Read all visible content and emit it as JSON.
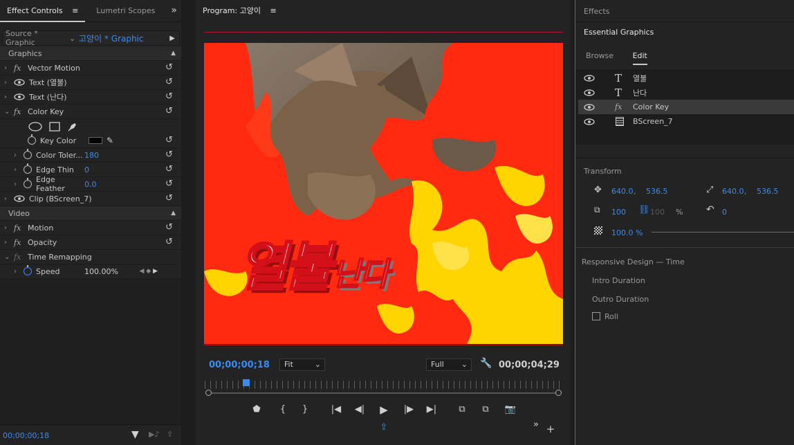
{
  "effect_controls": {
    "tabs": [
      {
        "label": "Effect Controls",
        "menu": "≡"
      },
      {
        "label": "Lumetri Scopes"
      }
    ],
    "overflow": "»",
    "source_label": "Source * Graphic",
    "sequence_clip_label": "고양이 * Graphic",
    "sections": {
      "graphics": "Graphics",
      "video": "Video"
    },
    "rows": {
      "vector_motion": "Vector Motion",
      "text1": "Text (열불)",
      "text2": "Text (난다)",
      "color_key": "Color Key",
      "key_color": "Key Color",
      "color_tolerance": "Color Toler...",
      "color_tolerance_value": "180",
      "edge_thin": "Edge Thin",
      "edge_thin_value": "0",
      "edge_feather": "Edge Feather",
      "edge_feather_value": "0.0",
      "clip": "Clip (BScreen_7)",
      "motion": "Motion",
      "opacity": "Opacity",
      "time_remapping": "Time Remapping",
      "speed": "Speed",
      "speed_value": "100.00%"
    },
    "timecode": "00;00;00;18"
  },
  "program": {
    "title": "Program: 고양이",
    "menu": "≡",
    "overlay_text_big": "열불",
    "overlay_text_small": "난다",
    "current_time": "00;00;00;18",
    "fit": "Fit",
    "quality": "Full",
    "duration": "00;00;04;29"
  },
  "essential_graphics": {
    "effects_tab": "Effects",
    "panel_title": "Essential Graphics",
    "tabs": {
      "browse": "Browse",
      "edit": "Edit"
    },
    "layers": [
      {
        "name": "열불",
        "icon": "T"
      },
      {
        "name": "난다",
        "icon": "T"
      },
      {
        "name": "Color Key",
        "icon": "fx"
      },
      {
        "name": "BScreen_7",
        "icon": "film"
      }
    ],
    "transform_label": "Transform",
    "position_x": "640.0",
    "position_y": "536.5",
    "anchor_x": "640.0",
    "anchor_y": "536.5",
    "scale": "100",
    "scale_linked": "100",
    "scale_unit": "%",
    "rotation": "0",
    "opacity": "100.0 %",
    "responsive_title": "Responsive Design — Time",
    "intro": "Intro Duration",
    "outro": "Outro Duration",
    "roll": "Roll"
  },
  "colors": {
    "accent": "#3b8bf0",
    "flame_red": "#ff2a10",
    "flame_yellow": "#ffd400"
  }
}
